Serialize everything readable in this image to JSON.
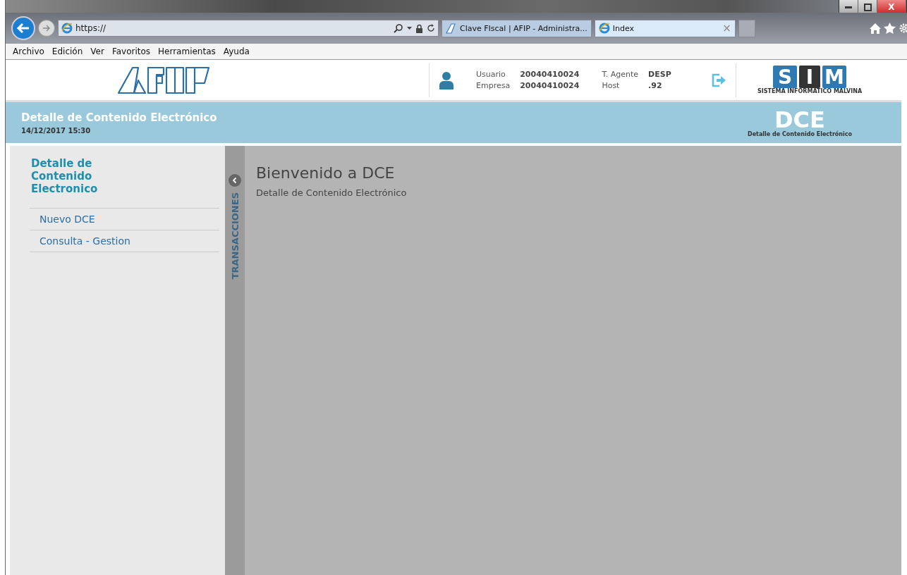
{
  "browser": {
    "address": "https://",
    "tabs": [
      {
        "label": "Clave FIscal | AFIP - Administra...",
        "kind": "afip",
        "selected": false
      },
      {
        "label": "Index",
        "kind": "ie",
        "selected": true
      }
    ],
    "close_tab": "×",
    "window_close": "X"
  },
  "menu": [
    "Archivo",
    "Edición",
    "Ver",
    "Favoritos",
    "Herramientas",
    "Ayuda"
  ],
  "header": {
    "user_info": [
      {
        "label": "Usuario",
        "value": "20040410024"
      },
      {
        "label": "Empresa",
        "value": "20040410024"
      }
    ],
    "agent_info": [
      {
        "label": "T. Agente",
        "value": "DESP"
      },
      {
        "label": "Host",
        "value": ".92"
      }
    ],
    "sim_letters": [
      "S",
      "I",
      "M"
    ],
    "sim_caption": "SISTEMA INFORMÁTICO MALVINA"
  },
  "banner": {
    "title": "Detalle de Contenido Electrónico",
    "datetime": "14/12/2017 15:30",
    "acronym": "DCE",
    "acronym_caption": "Detalle de Contenido Electrónico"
  },
  "sidebar": {
    "title": "Detalle de Contenido Electronico",
    "items": [
      "Nuevo DCE",
      "Consulta - Gestion"
    ],
    "tab_label": "TRANSACCIONES"
  },
  "main": {
    "heading": "Bienvenido a DCE",
    "subtitle": "Detalle de Contenido Electrónico"
  }
}
